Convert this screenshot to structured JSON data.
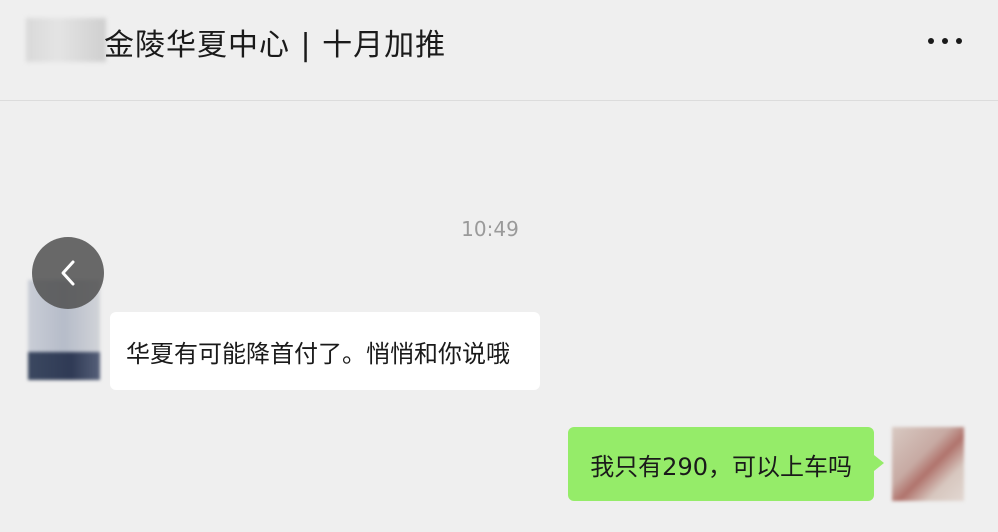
{
  "header": {
    "title": "金陵华夏中心 | 十月加推"
  },
  "chat": {
    "timestamp": "10:49",
    "messages": [
      {
        "side": "left",
        "text": "华夏有可能降首付了。悄悄和你说哦"
      },
      {
        "side": "right",
        "text": "我只有290，可以上车吗"
      }
    ]
  },
  "colors": {
    "background": "#efefef",
    "outgoing_bubble": "#95ec69",
    "incoming_bubble": "#ffffff"
  },
  "icons": {
    "more": "more-icon",
    "back": "chevron-left-icon"
  }
}
